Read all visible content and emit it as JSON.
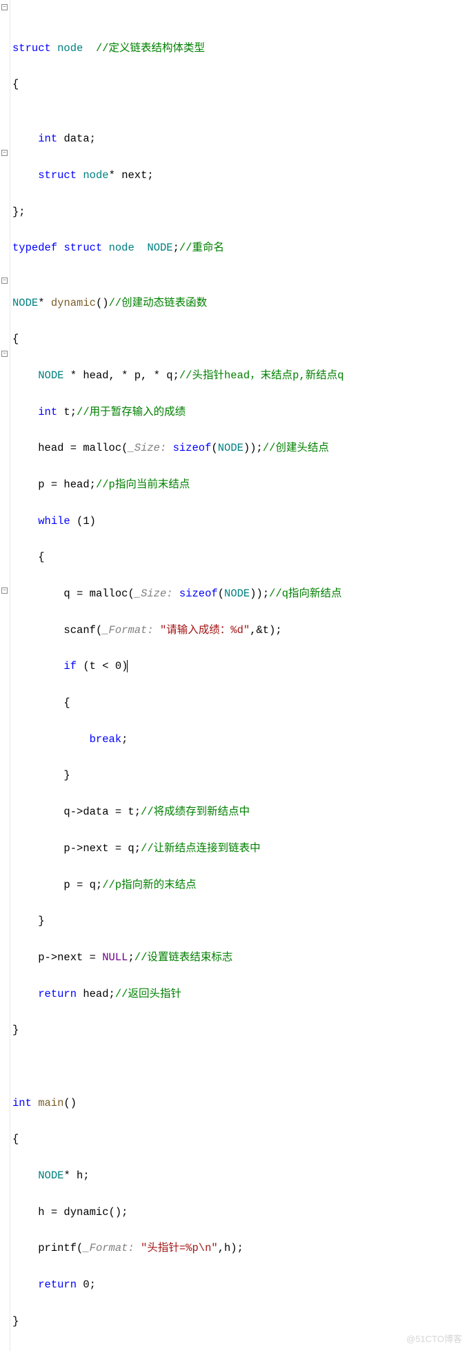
{
  "watermark": "@51CTO博客",
  "fold_glyph": "−",
  "code": {
    "l1": {
      "kw": "struct",
      "type": "node",
      "cmt": "//定义链表结构体类型"
    },
    "l2": {
      "brace": "{"
    },
    "l3": {
      "blank": ""
    },
    "l4": {
      "kw": "int",
      "id": "data",
      "semi": ";"
    },
    "l5": {
      "kw": "struct",
      "type": "node",
      "ptr": "*",
      "id": "next",
      "semi": ";"
    },
    "l6": {
      "brace": "};"
    },
    "l7": {
      "kw": "typedef",
      "kw2": "struct",
      "type": "node",
      "typedef": "NODE",
      "semi": ";",
      "cmt": "//重命名"
    },
    "l8": {
      "blank": ""
    },
    "l9": {
      "type": "NODE",
      "ptr": "*",
      "func": "dynamic",
      "paren": "()",
      "cmt": "//创建动态链表函数"
    },
    "l10": {
      "brace": "{"
    },
    "l11": {
      "type": "NODE",
      "decl": " * head, * p, * q;",
      "cmt": "//头指针head，末结点p,新结点q"
    },
    "l12": {
      "kw": "int",
      "id": " t;",
      "cmt": "//用于暂存输入的成绩"
    },
    "l13": {
      "lhs": "head = ",
      "call": "malloc",
      "open": "(",
      "hint": "_Size:",
      "sz": " sizeof",
      "arg": "(",
      "type": "NODE",
      "close": "));",
      "cmt": "//创建头结点"
    },
    "l14": {
      "stmt": "p = head;",
      "cmt": "//p指向当前末结点"
    },
    "l15": {
      "kw": "while",
      "cond": " (1)"
    },
    "l16": {
      "brace": "{"
    },
    "l17": {
      "lhs": "q = ",
      "call": "malloc",
      "open": "(",
      "hint": "_Size:",
      "sz": " sizeof",
      "arg": "(",
      "type": "NODE",
      "close": "));",
      "cmt": "//q指向新结点"
    },
    "l18": {
      "call": "scanf",
      "open": "(",
      "hint": "_Format:",
      "str": " \"请输入成绩：%d\"",
      "rest": ",&t);"
    },
    "l19": {
      "kw": "if",
      "cond": " (t < 0)"
    },
    "l20": {
      "brace": "{"
    },
    "l21": {
      "kw": "break",
      "semi": ";"
    },
    "l22": {
      "brace": "}"
    },
    "l23": {
      "stmt": "q->data = t;",
      "cmt": "//将成绩存到新结点中"
    },
    "l24": {
      "stmt": "p->next = q;",
      "cmt": "//让新结点连接到链表中"
    },
    "l25": {
      "stmt": "p = q;",
      "cmt": "//p指向新的末结点"
    },
    "l26": {
      "brace": "}"
    },
    "l27": {
      "lhs": "p->next = ",
      "macro": "NULL",
      "semi": ";",
      "cmt": "//设置链表结束标志"
    },
    "l28": {
      "kw": "return",
      "id": " head;",
      "cmt": "//返回头指针"
    },
    "l29": {
      "brace": "}"
    },
    "l30": {
      "blank": ""
    },
    "l31": {
      "blank": ""
    },
    "l32": {
      "kw": "int",
      "func": " main",
      "paren": "()"
    },
    "l33": {
      "brace": "{"
    },
    "l34": {
      "type": "NODE",
      "id": "* h;"
    },
    "l35": {
      "stmt": "h = dynamic();"
    },
    "l36": {
      "call": "printf",
      "open": "(",
      "hint": "_Format:",
      "str": " \"头指针=%p\\n\"",
      "rest": ",h);"
    },
    "l37": {
      "kw": "return",
      "num": " 0",
      "semi": ";"
    },
    "l38": {
      "brace": "}"
    }
  }
}
